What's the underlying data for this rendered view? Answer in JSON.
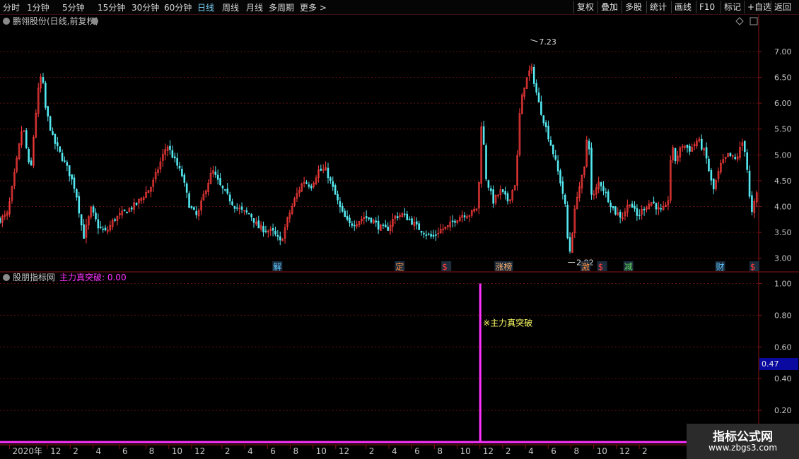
{
  "toolbar": {
    "periods": [
      "分时",
      "1分钟",
      "5分钟",
      "15分钟",
      "30分钟",
      "60分钟",
      "日线",
      "周线",
      "月线",
      "多周期",
      "更多 >"
    ],
    "active_period": "日线",
    "tools": [
      "复权",
      "叠加",
      "多股",
      "统计",
      "画线",
      "F10",
      "标记",
      "+自选",
      "返回"
    ]
  },
  "colors": {
    "up": "#ff3c3c",
    "down": "#54e8f0",
    "grid": "#5a1010",
    "indicator": "#ff33ff",
    "axis_text": "#c8c8c8",
    "signal_text": "#ffff66"
  },
  "chart_data": [
    {
      "type": "candlestick",
      "title": "鹏翎股份(日线,前复权)",
      "ylim": [
        2.75,
        7.45
      ],
      "yticks": [
        3.0,
        3.5,
        4.0,
        4.5,
        5.0,
        5.5,
        6.0,
        6.5,
        7.0
      ],
      "ytick_labels": [
        "3.00",
        "3.50",
        "4.00",
        "4.50",
        "5.00",
        "5.50",
        "6.00",
        "6.50",
        "7.00"
      ],
      "annotations": [
        {
          "text": "7.23",
          "index": 0.69,
          "value": 7.23
        },
        {
          "text": "2.92",
          "index": 0.66,
          "value": 2.92
        }
      ],
      "event_labels": [
        {
          "text": "解",
          "pos": 0.375,
          "color": "#5ac8ff"
        },
        {
          "text": "定",
          "pos": 0.543,
          "color": "#ff8c3c"
        },
        {
          "text": "$",
          "pos": 0.607,
          "color": "#ff3c3c"
        },
        {
          "text": "涨榜",
          "pos": 0.68,
          "color": "#ffb070"
        },
        {
          "text": "激",
          "pos": 0.798,
          "color": "#ff8c3c"
        },
        {
          "text": "$",
          "pos": 0.821,
          "color": "#ff3c3c"
        },
        {
          "text": "减",
          "pos": 0.857,
          "color": "#5cd85c"
        },
        {
          "text": "财",
          "pos": 0.983,
          "color": "#5ac8ff"
        },
        {
          "text": "$",
          "pos": 1.03,
          "color": "#ff3c3c"
        }
      ],
      "close_path": [
        [
          0,
          3.75
        ],
        [
          0.01,
          3.85
        ],
        [
          0.02,
          4.7
        ],
        [
          0.03,
          5.6
        ],
        [
          0.04,
          4.6
        ],
        [
          0.045,
          5.5
        ],
        [
          0.05,
          6.2
        ],
        [
          0.055,
          6.6
        ],
        [
          0.06,
          5.9
        ],
        [
          0.07,
          5.3
        ],
        [
          0.08,
          5.0
        ],
        [
          0.09,
          4.7
        ],
        [
          0.1,
          4.3
        ],
        [
          0.11,
          3.4
        ],
        [
          0.12,
          3.95
        ],
        [
          0.13,
          3.6
        ],
        [
          0.14,
          3.5
        ],
        [
          0.15,
          3.75
        ],
        [
          0.16,
          3.85
        ],
        [
          0.18,
          4.05
        ],
        [
          0.2,
          4.4
        ],
        [
          0.21,
          4.8
        ],
        [
          0.22,
          5.2
        ],
        [
          0.23,
          4.9
        ],
        [
          0.24,
          4.6
        ],
        [
          0.25,
          4.0
        ],
        [
          0.26,
          3.8
        ],
        [
          0.27,
          4.3
        ],
        [
          0.28,
          4.7
        ],
        [
          0.29,
          4.4
        ],
        [
          0.3,
          4.2
        ],
        [
          0.31,
          4.0
        ],
        [
          0.32,
          3.9
        ],
        [
          0.33,
          3.85
        ],
        [
          0.34,
          3.6
        ],
        [
          0.35,
          3.55
        ],
        [
          0.36,
          3.5
        ],
        [
          0.37,
          3.3
        ],
        [
          0.38,
          3.8
        ],
        [
          0.39,
          4.2
        ],
        [
          0.4,
          4.5
        ],
        [
          0.41,
          4.4
        ],
        [
          0.42,
          4.7
        ],
        [
          0.43,
          4.7
        ],
        [
          0.44,
          4.3
        ],
        [
          0.45,
          3.9
        ],
        [
          0.46,
          3.65
        ],
        [
          0.47,
          3.7
        ],
        [
          0.48,
          3.8
        ],
        [
          0.49,
          3.75
        ],
        [
          0.5,
          3.6
        ],
        [
          0.51,
          3.55
        ],
        [
          0.52,
          3.8
        ],
        [
          0.53,
          3.85
        ],
        [
          0.54,
          3.75
        ],
        [
          0.55,
          3.6
        ],
        [
          0.56,
          3.5
        ],
        [
          0.57,
          3.4
        ],
        [
          0.58,
          3.55
        ],
        [
          0.59,
          3.6
        ],
        [
          0.6,
          3.75
        ],
        [
          0.61,
          3.85
        ],
        [
          0.62,
          3.85
        ],
        [
          0.63,
          4.0
        ],
        [
          0.635,
          5.8
        ],
        [
          0.64,
          4.6
        ],
        [
          0.65,
          4.1
        ],
        [
          0.66,
          4.3
        ],
        [
          0.67,
          4.1
        ],
        [
          0.68,
          4.5
        ],
        [
          0.685,
          5.8
        ],
        [
          0.69,
          6.3
        ],
        [
          0.7,
          6.7
        ],
        [
          0.71,
          6.0
        ],
        [
          0.72,
          5.5
        ],
        [
          0.73,
          5.0
        ],
        [
          0.74,
          4.4
        ],
        [
          0.745,
          4.0
        ],
        [
          0.75,
          3.0
        ],
        [
          0.76,
          4.2
        ],
        [
          0.77,
          4.7
        ],
        [
          0.775,
          5.6
        ],
        [
          0.78,
          4.1
        ],
        [
          0.79,
          4.5
        ],
        [
          0.8,
          4.2
        ],
        [
          0.81,
          3.9
        ],
        [
          0.82,
          3.8
        ],
        [
          0.83,
          4.1
        ],
        [
          0.84,
          3.8
        ],
        [
          0.85,
          4.0
        ],
        [
          0.86,
          4.1
        ],
        [
          0.87,
          3.9
        ],
        [
          0.88,
          4.0
        ],
        [
          0.885,
          5.2
        ],
        [
          0.89,
          4.9
        ],
        [
          0.9,
          5.2
        ],
        [
          0.91,
          5.1
        ],
        [
          0.92,
          5.3
        ],
        [
          0.93,
          5.0
        ],
        [
          0.94,
          4.3
        ],
        [
          0.95,
          4.8
        ],
        [
          0.96,
          5.0
        ],
        [
          0.97,
          4.9
        ],
        [
          0.98,
          5.3
        ],
        [
          0.985,
          4.7
        ],
        [
          0.99,
          3.8
        ],
        [
          1.0,
          4.4
        ],
        [
          1.01,
          4.7
        ],
        [
          1.02,
          5.0
        ],
        [
          1.03,
          5.1
        ],
        [
          1.04,
          4.9
        ],
        [
          1.05,
          5.2
        ],
        [
          1.06,
          5.4
        ],
        [
          1.065,
          6.0
        ],
        [
          1.07,
          5.7
        ]
      ]
    },
    {
      "type": "bar",
      "title": "股朋指标网",
      "series_label": "主力真突破: 0.00",
      "ylim": [
        0,
        1.02
      ],
      "yticks": [
        0.2,
        0.4,
        0.6,
        0.8,
        1.0
      ],
      "ytick_labels": [
        "0.20",
        "0.40",
        "0.60",
        "0.80",
        "1.00"
      ],
      "current_value_label": "0.47",
      "signal": {
        "pos": 0.633,
        "value": 1.0,
        "text": "※主力真突破"
      }
    }
  ],
  "x_axis": {
    "labels": [
      "2020年",
      "12",
      "2",
      "4",
      "6",
      "8",
      "10",
      "12",
      "2",
      "4",
      "6",
      "8",
      "10",
      "12",
      "2",
      "4",
      "6",
      "8",
      "10",
      "12",
      "2",
      "4",
      "6",
      "8",
      "10",
      "12",
      "2"
    ],
    "positions": [
      0.02,
      0.07,
      0.1,
      0.13,
      0.165,
      0.2,
      0.23,
      0.26,
      0.3,
      0.33,
      0.36,
      0.39,
      0.42,
      0.45,
      0.49,
      0.52,
      0.55,
      0.58,
      0.61,
      0.64,
      0.67,
      0.7,
      0.73,
      0.76,
      0.79,
      0.82,
      0.85
    ]
  },
  "watermark": {
    "line1": "指标公式网",
    "line2": "www.zbgs3.com"
  }
}
